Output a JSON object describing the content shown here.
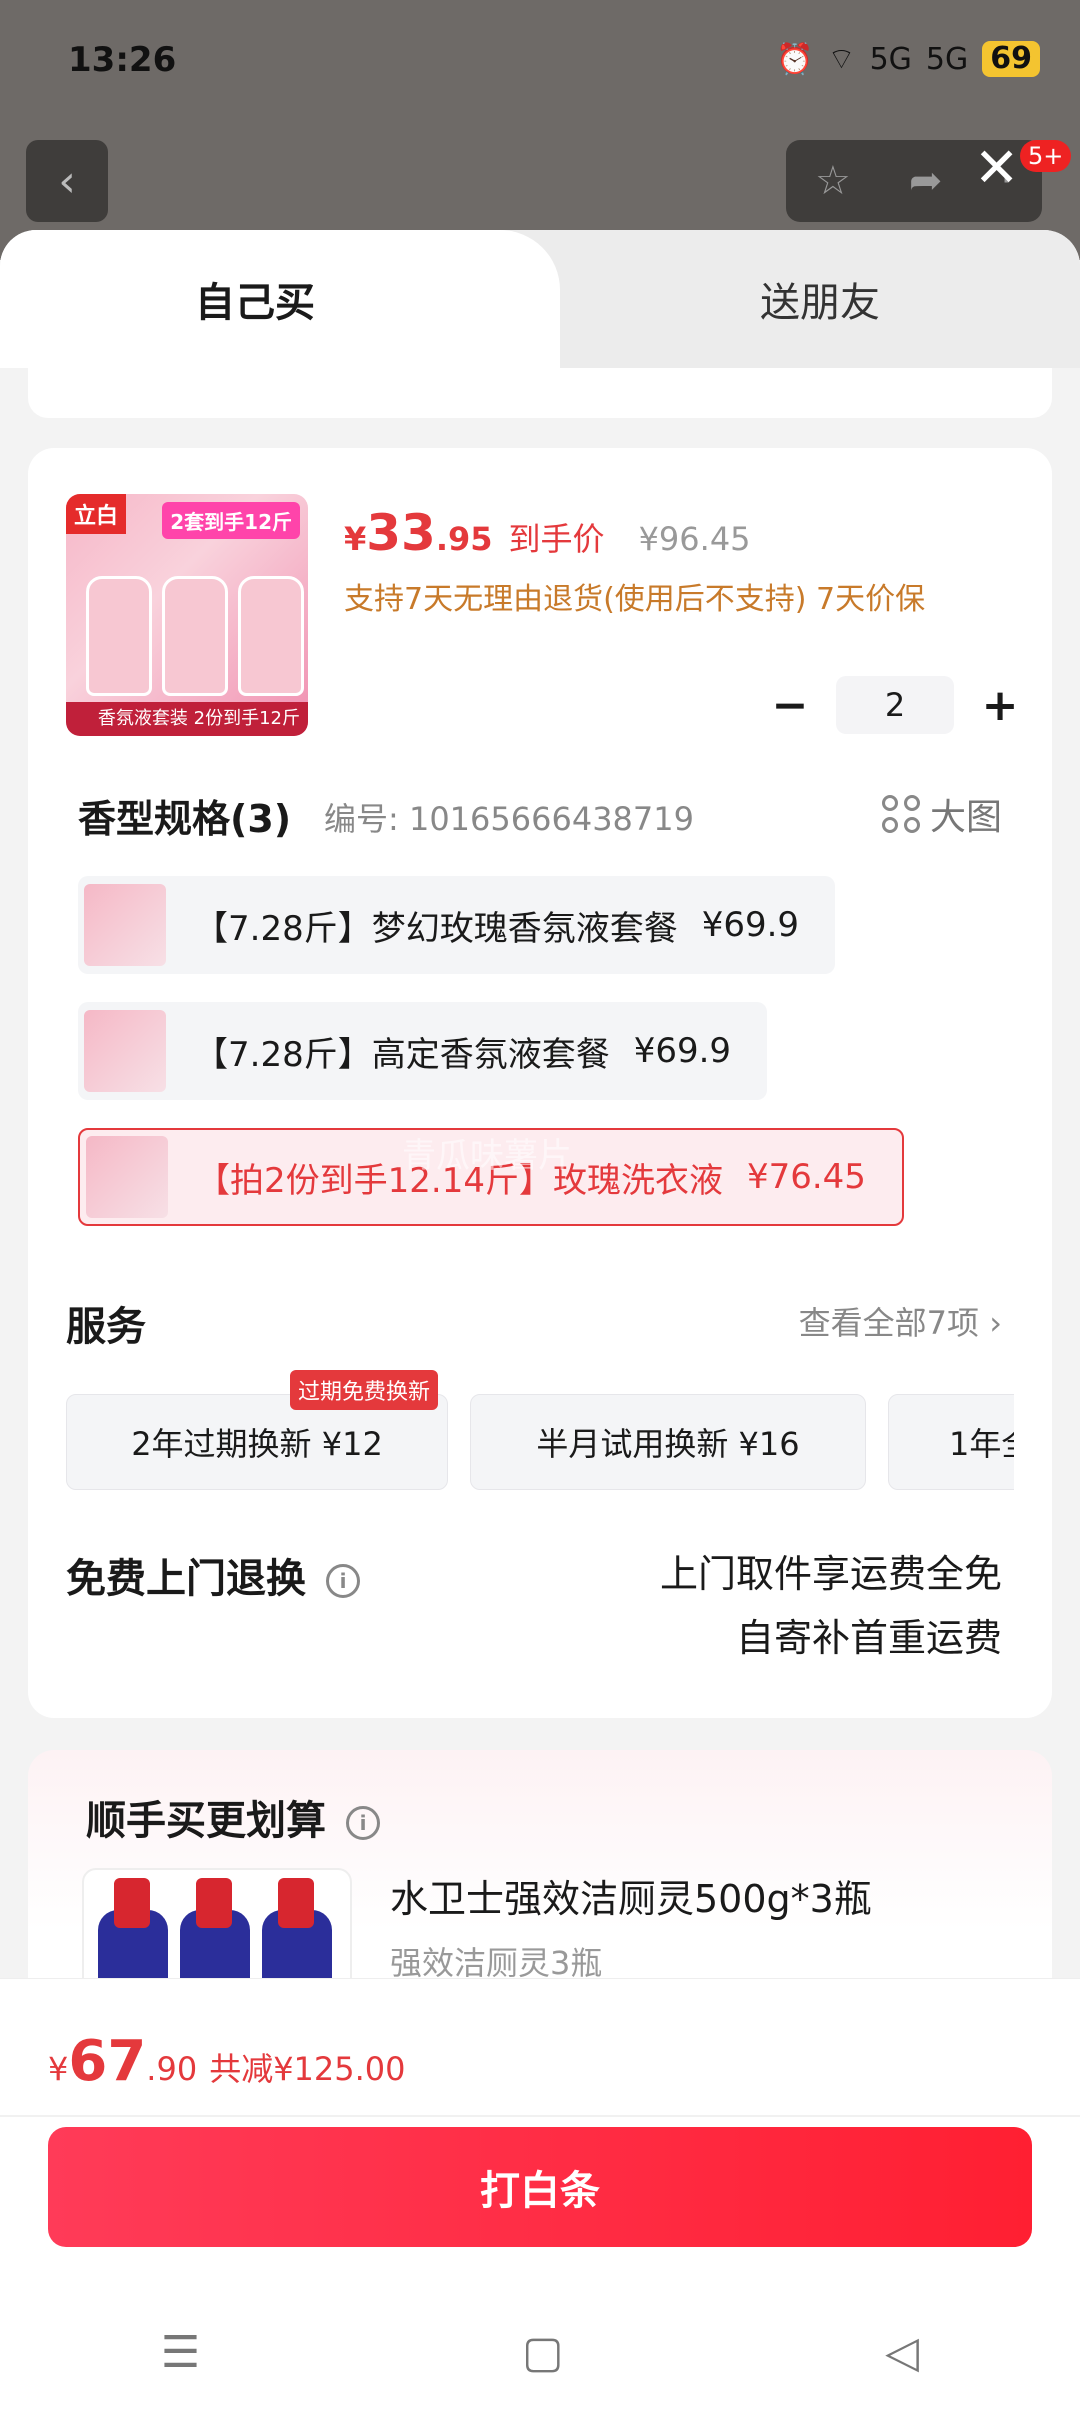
{
  "status_bar": {
    "time": "13:26",
    "signal1": "5G",
    "signal2": "5G",
    "battery": "69"
  },
  "top_actions": {
    "back_icon": "chevron-left-icon",
    "close_icon": "close-icon",
    "badge": "5+"
  },
  "tabs": [
    {
      "label": "自己买"
    },
    {
      "label": "送朋友"
    }
  ],
  "product": {
    "thumb_tag": "立白",
    "thumb_badge": "2套到手12斤",
    "thumb_foot": "香氛液套装 2份到手12斤",
    "price_currency": "¥",
    "price_int": "33",
    "price_dec": ".95",
    "price_label": "到手价",
    "price_old": "¥96.45",
    "returns": "支持7天无理由退货(使用后不支持) 7天价保"
  },
  "quantity": {
    "minus": "−",
    "value": "2",
    "plus": "+"
  },
  "spec": {
    "title": "香型规格(3)",
    "code": "编号: 10165666438719",
    "big_view": "大图",
    "options": [
      {
        "label": "【7.28斤】梦幻玫瑰香氛液套餐",
        "price": "¥69.9",
        "selected": false
      },
      {
        "label": "【7.28斤】高定香氛液套餐",
        "price": "¥69.9",
        "selected": false
      },
      {
        "label": "【拍2份到手12.14斤】玫瑰洗衣液",
        "price": "¥76.45",
        "selected": true
      }
    ]
  },
  "watermark": "青瓜味薯片",
  "services": {
    "title": "服务",
    "view_all": "查看全部7项",
    "tag": "过期免费换新",
    "items": [
      "2年过期换新 ¥12",
      "半月试用换新 ¥16",
      "1年全"
    ]
  },
  "free_return": {
    "title": "免费上门退换",
    "line1": "上门取件享运费全免",
    "line2": "自寄补首重运费"
  },
  "addon": {
    "title": "顺手买更划算",
    "item_title": "水卫士强效洁厕灵500g*3瓶",
    "item_sub": "强效洁厕灵3瓶"
  },
  "footer": {
    "currency": "¥",
    "total_int": "67",
    "total_dec": ".90",
    "discount": "共减¥125.00",
    "pay_button": "打白条"
  },
  "nav": {
    "menu_icon": "menu-icon",
    "home_icon": "square-icon",
    "back_icon": "triangle-back-icon"
  },
  "colors": {
    "accent": "#e4393c",
    "button": "#ff2a40",
    "returns_text": "#c87a2a"
  }
}
